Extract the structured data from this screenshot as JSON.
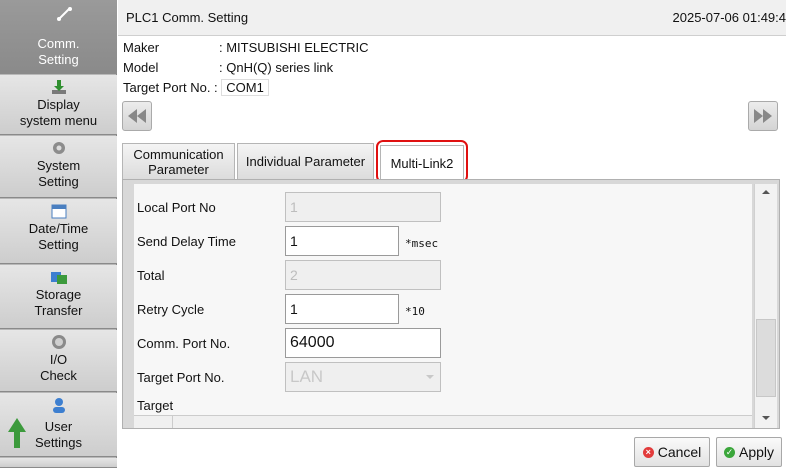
{
  "sidebar": {
    "items": [
      {
        "label_line1": "Comm.",
        "label_line2": "Setting",
        "icon": "network-icon",
        "active": true
      },
      {
        "label_line1": "Display",
        "label_line2": "system menu",
        "icon": "download-icon"
      },
      {
        "label_line1": "System",
        "label_line2": "Setting",
        "icon": "gear-icon"
      },
      {
        "label_line1": "Date/Time",
        "label_line2": "Setting",
        "icon": "calendar-icon"
      },
      {
        "label_line1": "Storage",
        "label_line2": "Transfer",
        "icon": "transfer-icon"
      },
      {
        "label_line1": "I/O",
        "label_line2": "Check",
        "icon": "gauge-icon"
      },
      {
        "label_line1": "User",
        "label_line2": "Settings",
        "icon": "user-icon"
      }
    ]
  },
  "header": {
    "title": "PLC1 Comm. Setting",
    "datetime": "2025-07-06 01:49:4"
  },
  "info": {
    "maker_label": "Maker",
    "maker_value": ": MITSUBISHI ELECTRIC",
    "model_label": "Model",
    "model_value": ": QnH(Q) series link",
    "port_label": "Target Port No. :",
    "port_value": "COM1"
  },
  "tabs": [
    {
      "label_line1": "Communication",
      "label_line2": "Parameter"
    },
    {
      "label": "Individual Parameter"
    },
    {
      "label": "Multi-Link2",
      "active": true
    }
  ],
  "form": {
    "local_port_label": "Local Port No",
    "local_port_value": "1",
    "send_delay_label": "Send Delay Time",
    "send_delay_value": "1",
    "send_delay_unit": "*msec",
    "total_label": "Total",
    "total_value": "2",
    "retry_label": "Retry Cycle",
    "retry_value": "1",
    "retry_unit": "*10",
    "comm_port_label": "Comm. Port No.",
    "comm_port_value": "64000",
    "target_port_label": "Target Port No.",
    "target_port_value": "LAN",
    "target_label": "Target"
  },
  "buttons": {
    "cancel": "Cancel",
    "apply": "Apply"
  },
  "colors": {
    "highlight": "#e01010",
    "cancel_icon": "#e23b3b",
    "apply_icon": "#3aa63a"
  }
}
